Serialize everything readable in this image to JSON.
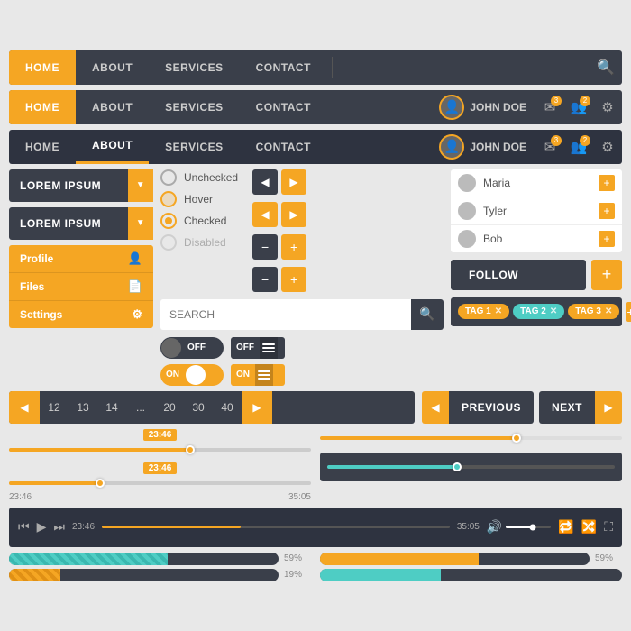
{
  "nav1": {
    "items": [
      "HOME",
      "ABOUT",
      "SERVICES",
      "CONTACT"
    ],
    "active": "HOME"
  },
  "nav2": {
    "items": [
      "HOME",
      "ABOUT",
      "SERVICES",
      "CONTACT"
    ],
    "active": "HOME",
    "user": "JOHN DOE"
  },
  "nav3": {
    "items": [
      "HOME",
      "ABOUT",
      "SERVICES",
      "CONTACT"
    ],
    "active": "ABOUT",
    "underline": "ABOUT",
    "user": "JOHN DOE"
  },
  "dropdown": {
    "label": "LOREM IPSUM",
    "label2": "LOREM IPSUM"
  },
  "menu": {
    "items": [
      "Profile",
      "Files",
      "Settings"
    ]
  },
  "radios": {
    "unchecked": "Unchecked",
    "hover": "Hover",
    "checked": "Checked",
    "disabled": "Disabled"
  },
  "search": {
    "placeholder": "SEARCH"
  },
  "follow": {
    "label": "FOLLOW"
  },
  "users": [
    {
      "name": "Maria"
    },
    {
      "name": "Tyler"
    },
    {
      "name": "Bob"
    }
  ],
  "tags": [
    {
      "label": "TAG 1"
    },
    {
      "label": "TAG 2"
    },
    {
      "label": "TAG 3"
    }
  ],
  "pagination": {
    "pages": [
      "12",
      "13",
      "14",
      "...",
      "20",
      "30",
      "40"
    ],
    "prev": "PREVIOUS",
    "next": "NEXT"
  },
  "slider": {
    "time1": "23:46",
    "time2": "35:05",
    "current": "23:46"
  },
  "player": {
    "time_current": "23:46",
    "time_total": "35:05"
  },
  "progress": {
    "bar1_pct": "59%",
    "bar2_pct": "59%",
    "bar3_pct": "19%"
  }
}
